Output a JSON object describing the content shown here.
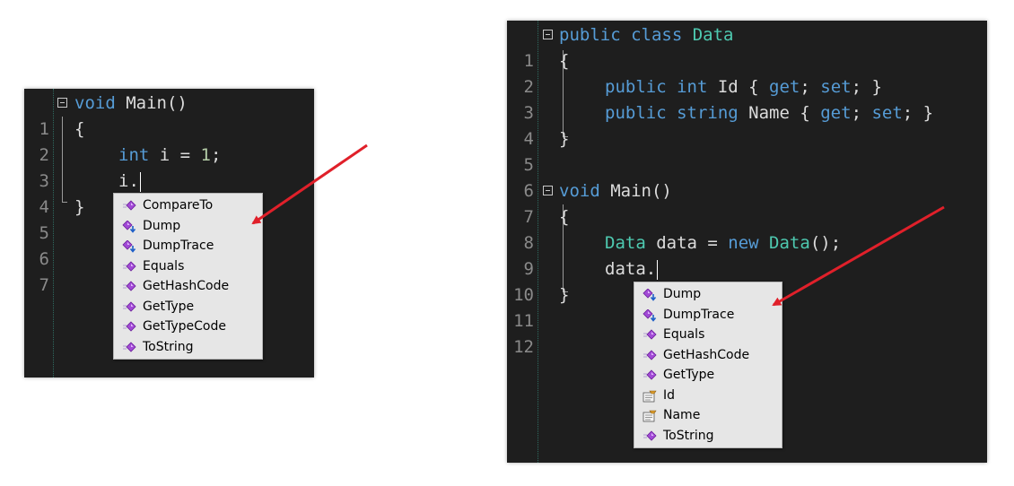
{
  "left_editor": {
    "line_numbers": [
      "1",
      "2",
      "3",
      "4",
      "5",
      "6",
      "7"
    ],
    "code": {
      "l1_kw": "void",
      "l1_rest": " Main()",
      "l2": "{",
      "l3_kw": "int",
      "l3_mid": " i = ",
      "l3_num": "1",
      "l3_end": ";",
      "l4": "i.",
      "l5": "}"
    },
    "completion_items": [
      {
        "label": "CompareTo",
        "icon": "method-icon"
      },
      {
        "label": "Dump",
        "icon": "extension-method-icon"
      },
      {
        "label": "DumpTrace",
        "icon": "extension-method-icon"
      },
      {
        "label": "Equals",
        "icon": "method-icon"
      },
      {
        "label": "GetHashCode",
        "icon": "method-icon"
      },
      {
        "label": "GetType",
        "icon": "method-icon"
      },
      {
        "label": "GetTypeCode",
        "icon": "method-icon"
      },
      {
        "label": "ToString",
        "icon": "method-icon"
      }
    ]
  },
  "right_editor": {
    "line_numbers": [
      "1",
      "2",
      "3",
      "4",
      "5",
      "6",
      "7",
      "8",
      "9",
      "10",
      "11",
      "12"
    ],
    "code": {
      "l1_kw": "public class",
      "l1_type": " Data",
      "l2": "{",
      "l3_kw1": "public int",
      "l3_mid": " Id { ",
      "l3_kw2": "get",
      "l3_semi": "; ",
      "l3_kw3": "set",
      "l3_end": "; }",
      "l4_kw1": "public string",
      "l4_mid": " Name { ",
      "l4_kw2": "get",
      "l4_semi": "; ",
      "l4_kw3": "set",
      "l4_end": "; }",
      "l5": "}",
      "l7_kw": "void",
      "l7_rest": " Main()",
      "l8": "{",
      "l9_type1": "Data",
      "l9_mid": " data = ",
      "l9_kw": "new",
      "l9_type2": " Data",
      "l9_end": "();",
      "l10": "data.",
      "l11": "}"
    },
    "completion_items": [
      {
        "label": "Dump",
        "icon": "extension-method-icon"
      },
      {
        "label": "DumpTrace",
        "icon": "extension-method-icon"
      },
      {
        "label": "Equals",
        "icon": "method-icon"
      },
      {
        "label": "GetHashCode",
        "icon": "method-icon"
      },
      {
        "label": "GetType",
        "icon": "method-icon"
      },
      {
        "label": "Id",
        "icon": "property-icon"
      },
      {
        "label": "Name",
        "icon": "property-icon"
      },
      {
        "label": "ToString",
        "icon": "method-icon"
      }
    ]
  },
  "colors": {
    "editor_bg": "#1e1e1e",
    "keyword": "#569cd6",
    "type": "#4ec9b0",
    "number": "#b5cea8",
    "annotation_arrow": "#e0202a"
  }
}
